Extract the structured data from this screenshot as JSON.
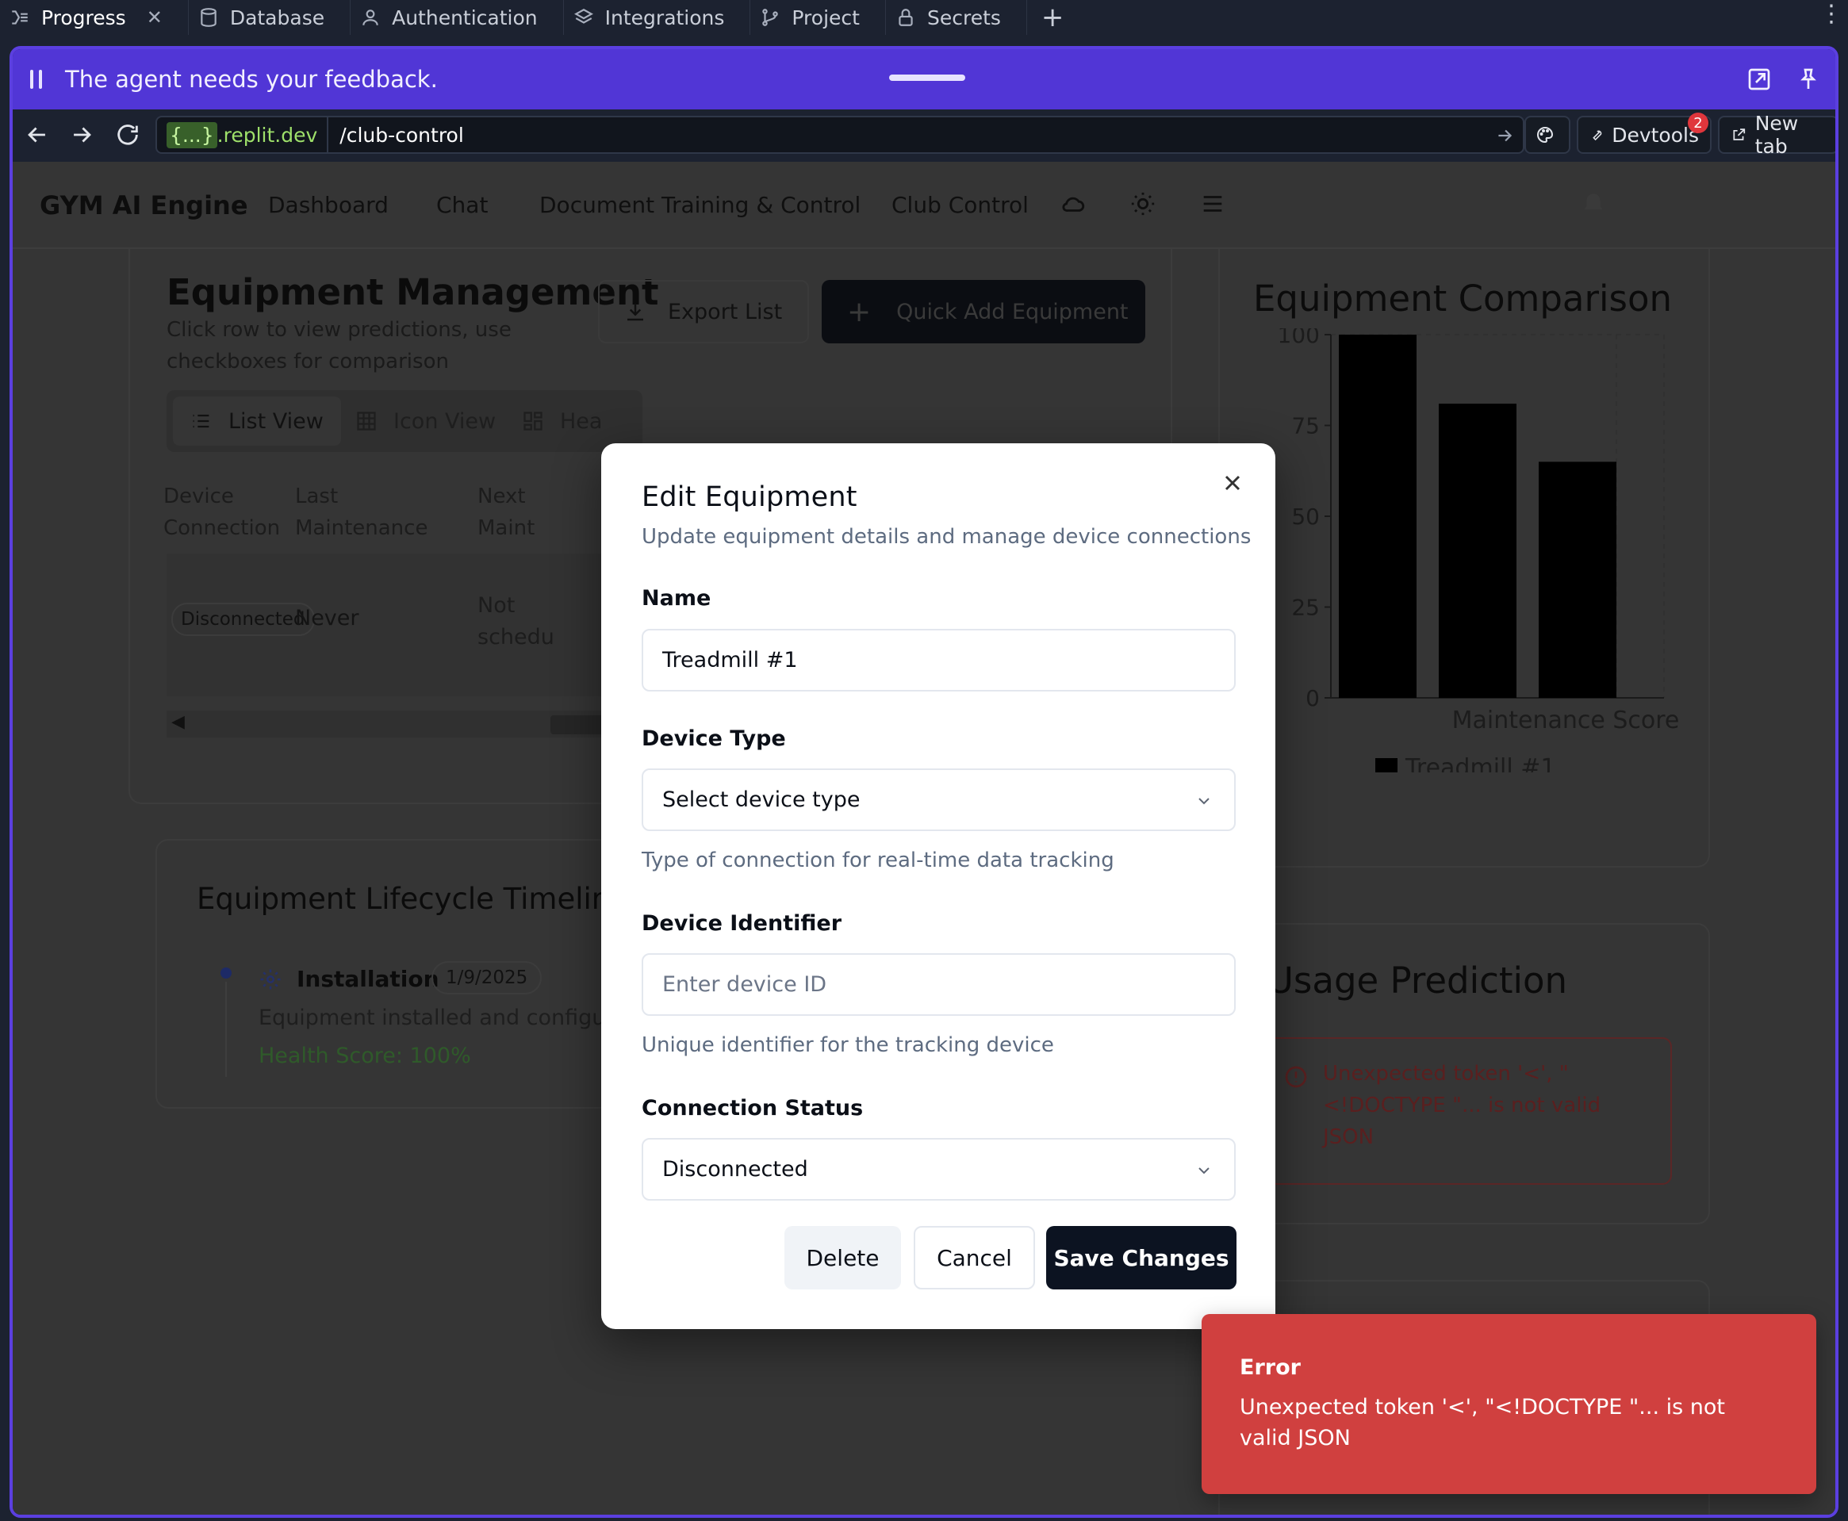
{
  "ide": {
    "tabs": [
      {
        "label": "Progress",
        "active": true
      },
      {
        "label": "Database"
      },
      {
        "label": "Authentication"
      },
      {
        "label": "Integrations"
      },
      {
        "label": "Project"
      },
      {
        "label": "Secrets"
      }
    ],
    "add_tab": "+"
  },
  "agent_banner": {
    "message": "The agent needs your feedback."
  },
  "browser": {
    "host_prefix": "{...}",
    "host_suffix": ".replit.dev",
    "path": "/club-control",
    "devtools_label": "Devtools",
    "devtools_badge": "2",
    "new_tab_label": "New tab"
  },
  "app": {
    "brand": "GYM AI Engine",
    "nav": [
      "Dashboard",
      "Chat",
      "Document Training & Control",
      "Club Control"
    ],
    "equipment": {
      "title": "Equipment Management",
      "subtitle_line1": "Click row to view predictions, use",
      "subtitle_line2": "checkboxes for comparison",
      "export_label": "Export List",
      "quick_add_label": "Quick Add Equipment",
      "views": [
        "List View",
        "Icon View",
        "Hea"
      ],
      "columns": [
        {
          "line1": "Device",
          "line2": "Connection"
        },
        {
          "line1": "Last",
          "line2": "Maintenance"
        },
        {
          "line1": "Next",
          "line2": "Maint"
        }
      ],
      "row": {
        "connection": "Disconnected",
        "last": "Never",
        "next_line1": "Not",
        "next_line2": "schedu"
      }
    },
    "timeline": {
      "title": "Equipment Lifecycle Timeline",
      "event": "Installation",
      "date": "1/9/2025",
      "desc": "Equipment installed and configure",
      "health": "Health Score: 100%"
    },
    "comparison": {
      "title": "Equipment Comparison"
    },
    "usage": {
      "title": "Usage Prediction",
      "error_line1": "Unexpected token '<', \"",
      "error_line2": "<!DOCTYPE \"... is not valid",
      "error_line3": "JSON"
    }
  },
  "chart_data": {
    "type": "bar",
    "categories": [
      "Maintenance Score"
    ],
    "series": [
      {
        "name": "Treadmill #1",
        "values": [
          100
        ]
      },
      {
        "values": [
          81
        ]
      },
      {
        "values": [
          65
        ]
      }
    ],
    "xlabel": "",
    "ylabel": "",
    "ylim": [
      0,
      100
    ],
    "yticks": [
      "0",
      "25",
      "50",
      "75",
      "100"
    ],
    "xtick": "Maintenance Score",
    "legend": "Treadmill #1",
    "legend_position": "bottom",
    "grid": true,
    "bar_color": "#000000"
  },
  "modal": {
    "title": "Edit Equipment",
    "subtitle": "Update equipment details and manage device connections",
    "name_label": "Name",
    "name_value": "Treadmill #1",
    "device_type_label": "Device Type",
    "device_type_value": "Select device type",
    "device_type_help": "Type of connection for real-time data tracking",
    "device_id_label": "Device Identifier",
    "device_id_placeholder": "Enter device ID",
    "device_id_help": "Unique identifier for the tracking device",
    "status_label": "Connection Status",
    "status_value": "Disconnected",
    "delete_label": "Delete",
    "cancel_label": "Cancel",
    "save_label": "Save Changes"
  },
  "toast": {
    "title": "Error",
    "message": "Unexpected token '<', \"<!DOCTYPE \"... is not valid JSON"
  },
  "colors": {
    "accent": "#5136d6",
    "toast_bg": "#d0403f",
    "save_bg": "#0c1321",
    "health_green": "#2f6a2a",
    "error_red": "#5a1a1a"
  }
}
